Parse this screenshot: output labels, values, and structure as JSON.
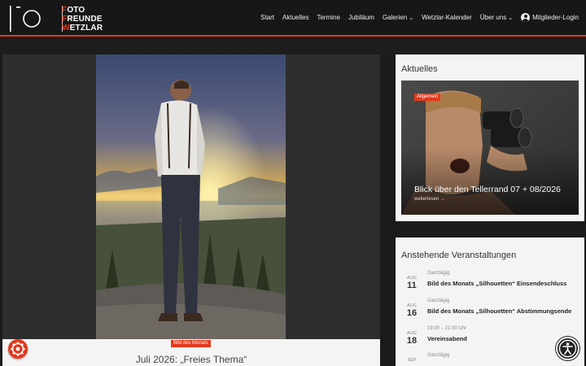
{
  "logo": {
    "lines": [
      "FOTO",
      "FREUNDE",
      "WETZLAR"
    ],
    "first_letters": [
      "F",
      "F",
      "W"
    ],
    "rests": [
      "OTO",
      "REUNDE",
      "ETZLAR"
    ]
  },
  "nav": {
    "items": [
      "Start",
      "Aktuelles",
      "Termine",
      "Jubiläum",
      "Galerien",
      "Wetzlar-Kalender",
      "Über uns",
      "Mitglieder-Login"
    ],
    "dropdown_icon": "chevron-down-icon",
    "login_icon": "user-icon"
  },
  "colors": {
    "accent": "#e2391c",
    "header_bg": "#171717",
    "panel_bg": "#f4f4f4"
  },
  "main": {
    "category": "Bild des Monats",
    "title": "Juli 2026: „Freies Thema“"
  },
  "news": {
    "title": "Aktuelles",
    "category": "Allgemein",
    "headline": "Blick über den Tellerrand 07 + 08/2026",
    "more": "weiterlesen →"
  },
  "events": {
    "title": "Anstehende Veranstaltungen",
    "items": [
      {
        "month": "AUG",
        "day": "11",
        "time": "Ganztägig",
        "title": "Bild des Monats „Silhouetten“ Einsendeschluss"
      },
      {
        "month": "AUG",
        "day": "16",
        "time": "Ganztägig",
        "title": "Bild des Monats „Silhouetten“ Abstimmungsende"
      },
      {
        "month": "AUG",
        "day": "18",
        "time": "19:00 – 21:00 Uhr",
        "title": "Vereinsabend"
      },
      {
        "month": "SEP",
        "day": "",
        "time": "Ganztägig",
        "title": ""
      }
    ]
  },
  "floating": {
    "cookie_icon": "cookie-icon",
    "accessibility_icon": "accessibility-icon"
  }
}
